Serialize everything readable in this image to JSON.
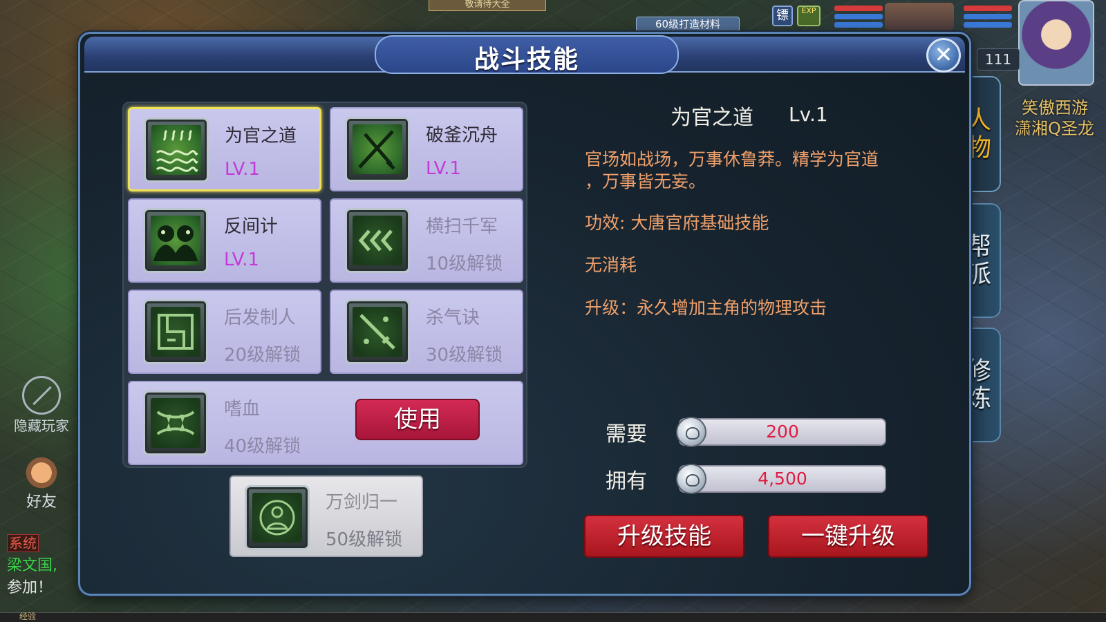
{
  "background": {
    "top_banner": "敬请待大全",
    "material_banner": "60级打造材料",
    "hud_icon_a": "镖",
    "hud_icon_b": "EXP",
    "level": "111",
    "name_line1": "笑傲西游",
    "name_line2": "潇湘Q圣龙",
    "hide_players_label": "隐藏玩家",
    "friends_label": "好友",
    "chat": {
      "system_tag": "系统",
      "sender": "梁文国,",
      "message": "参加！"
    },
    "exp_label": "经验"
  },
  "dialog": {
    "title": "战斗技能",
    "close_symbol": "✕"
  },
  "side_tabs": [
    {
      "label": "人物",
      "active": true
    },
    {
      "label": "帮派",
      "active": false
    },
    {
      "label": "修炼",
      "active": false
    }
  ],
  "skills": [
    {
      "name": "为官之道",
      "status": "LV.1",
      "icon": "waves-icon",
      "unlocked": true,
      "selected": true
    },
    {
      "name": "破釜沉舟",
      "status": "LV.1",
      "icon": "crossed-blades-icon",
      "unlocked": true,
      "selected": false
    },
    {
      "name": "反间计",
      "status": "LV.1",
      "icon": "two-faces-icon",
      "unlocked": true,
      "selected": false
    },
    {
      "name": "横扫千军",
      "status": "10级解锁",
      "icon": "chevrons-icon",
      "unlocked": false,
      "selected": false
    },
    {
      "name": "后发制人",
      "status": "20级解锁",
      "icon": "maze-icon",
      "unlocked": false,
      "selected": false
    },
    {
      "name": "杀气诀",
      "status": "30级解锁",
      "icon": "sword-icon",
      "unlocked": false,
      "selected": false
    },
    {
      "name": "嗜血",
      "status": "40级解锁",
      "icon": "fang-mouth-icon",
      "unlocked": false,
      "selected": false,
      "use_label": "使用"
    }
  ],
  "bonus_skill": {
    "name": "万剑归一",
    "status": "50级解锁",
    "icon": "buddha-icon"
  },
  "detail": {
    "name": "为官之道",
    "level": "Lv.1",
    "description_line1": "官场如战场，万事休鲁莽。精学为官道",
    "description_line2": "，万事皆无妄。",
    "effect": "功效: 大唐官府基础技能",
    "cost": "无消耗",
    "upgrade": "升级：永久增加主角的物理攻击"
  },
  "resources": {
    "need_label": "需要",
    "need_value": "200",
    "have_label": "拥有",
    "have_value": "4,500",
    "currency_icon": "silver-coin-icon"
  },
  "buttons": {
    "upgrade": "升级技能",
    "one_click_upgrade": "一键升级"
  },
  "colors": {
    "accent_tab": "#f5b52a",
    "level_text": "#c43ad8",
    "description": "#f0a06a",
    "red_button": "#c4202e"
  }
}
